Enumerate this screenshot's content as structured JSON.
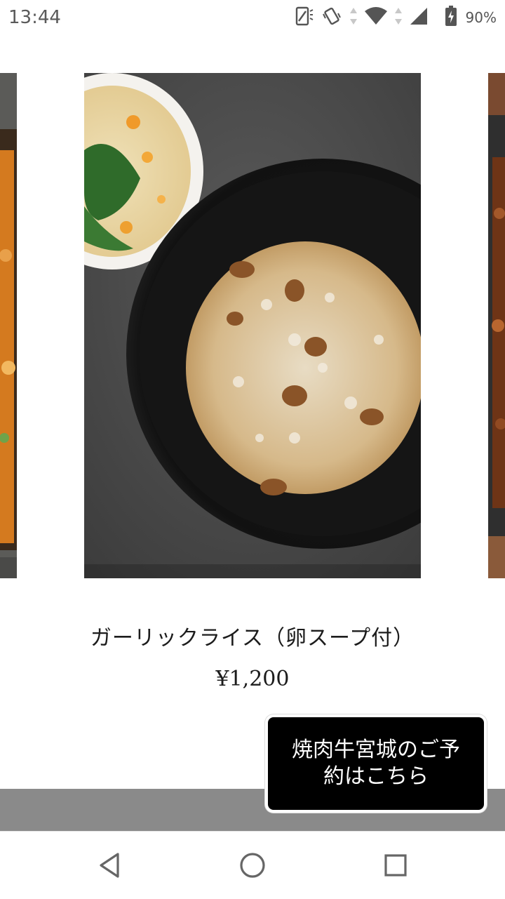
{
  "status_bar": {
    "time": "13:44",
    "battery_percent": "90%",
    "icons": [
      "screen-rotate-icon",
      "vibrate-icon",
      "data-arrows-icon",
      "wifi-icon",
      "cell-signal-icon",
      "battery-charging-icon"
    ]
  },
  "menu_item": {
    "name": "ガーリックライス（卵スープ付）",
    "price": "¥1,200"
  },
  "reserve_button": {
    "label": "焼肉牛宮城のご予約はこちら"
  },
  "nav_bar": {
    "icons": [
      "back-icon",
      "home-icon",
      "recents-icon"
    ]
  },
  "colors": {
    "background": "#ffffff",
    "bar": "#8a8a8a",
    "button_bg": "#000000",
    "button_text": "#ffffff"
  }
}
